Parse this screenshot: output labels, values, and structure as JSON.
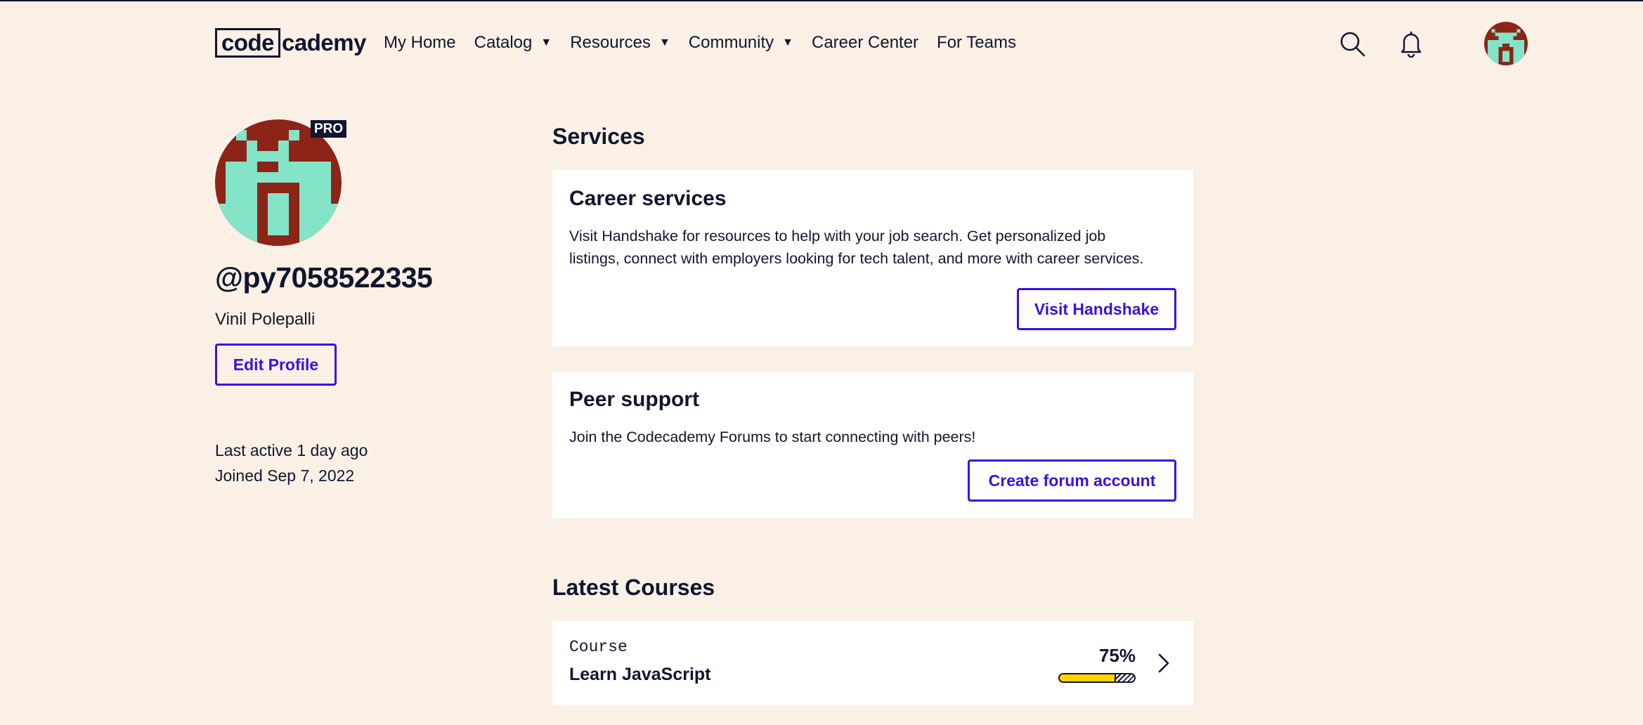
{
  "nav": {
    "logo_box": "code",
    "logo_rest": "cademy",
    "items": [
      {
        "label": "My Home"
      },
      {
        "label": "Catalog",
        "caret": "▼"
      },
      {
        "label": "Resources",
        "caret": "▼"
      },
      {
        "label": "Community",
        "caret": "▼"
      },
      {
        "label": "Career Center"
      },
      {
        "label": "For Teams"
      }
    ],
    "icons": [
      "search-icon",
      "bell-icon",
      "avatar"
    ]
  },
  "profile": {
    "badge": "PRO",
    "handle": "@py7058522335",
    "name": "Vinil Polepalli",
    "edit_label": "Edit Profile",
    "last_active": "Last active 1 day ago",
    "joined": "Joined Sep 7, 2022"
  },
  "colors": {
    "background": "#fbf0e6",
    "text": "#10162f",
    "accent": "#3a10e5",
    "avatar_red": "#8c2418",
    "avatar_mint": "#84e4c8",
    "progress_yellow": "#ffd300"
  },
  "services": {
    "title": "Services",
    "career": {
      "title": "Career services",
      "text": "Visit Handshake for resources to help with your job search. Get personalized job listings, connect with employers looking for tech talent, and more with career services.",
      "button": "Visit Handshake"
    },
    "peer": {
      "title": "Peer support",
      "text": "Join the Codecademy Forums to start connecting with peers!",
      "button": "Create forum account"
    }
  },
  "courses": {
    "title": "Latest Courses",
    "items": [
      {
        "kind": "Course",
        "name": "Learn JavaScript",
        "progress_label": "75%",
        "progress": 0.75
      }
    ]
  }
}
